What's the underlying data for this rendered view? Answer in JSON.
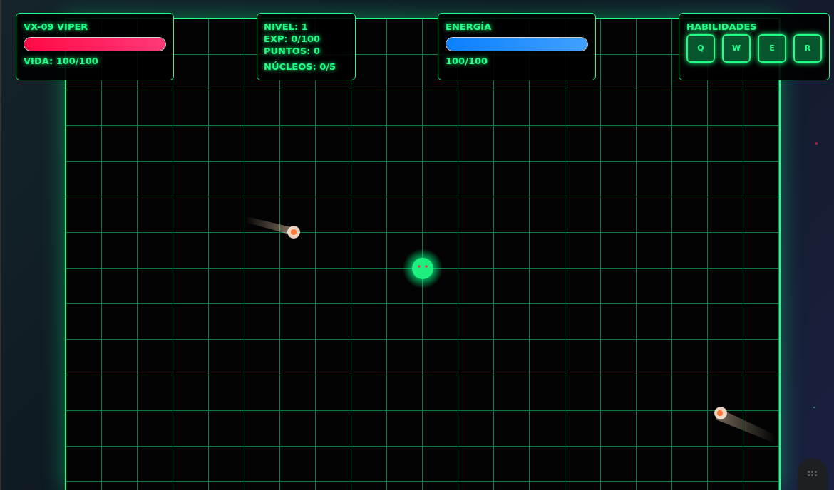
{
  "health": {
    "title": "VX-09 VIPER",
    "level": 1.0,
    "reading": "VIDA: 100/100"
  },
  "stats": [
    "NIVEL: 1",
    "EXP: 0/100",
    "PUNTOS: 0",
    "NÚCLEOS: 0/5"
  ],
  "energy": {
    "title": "ENERGÍA",
    "level": 1.0,
    "reading": "100/100"
  },
  "skills": {
    "title": "HABILIDADES",
    "keys": [
      "Q",
      "W",
      "E",
      "R"
    ]
  }
}
